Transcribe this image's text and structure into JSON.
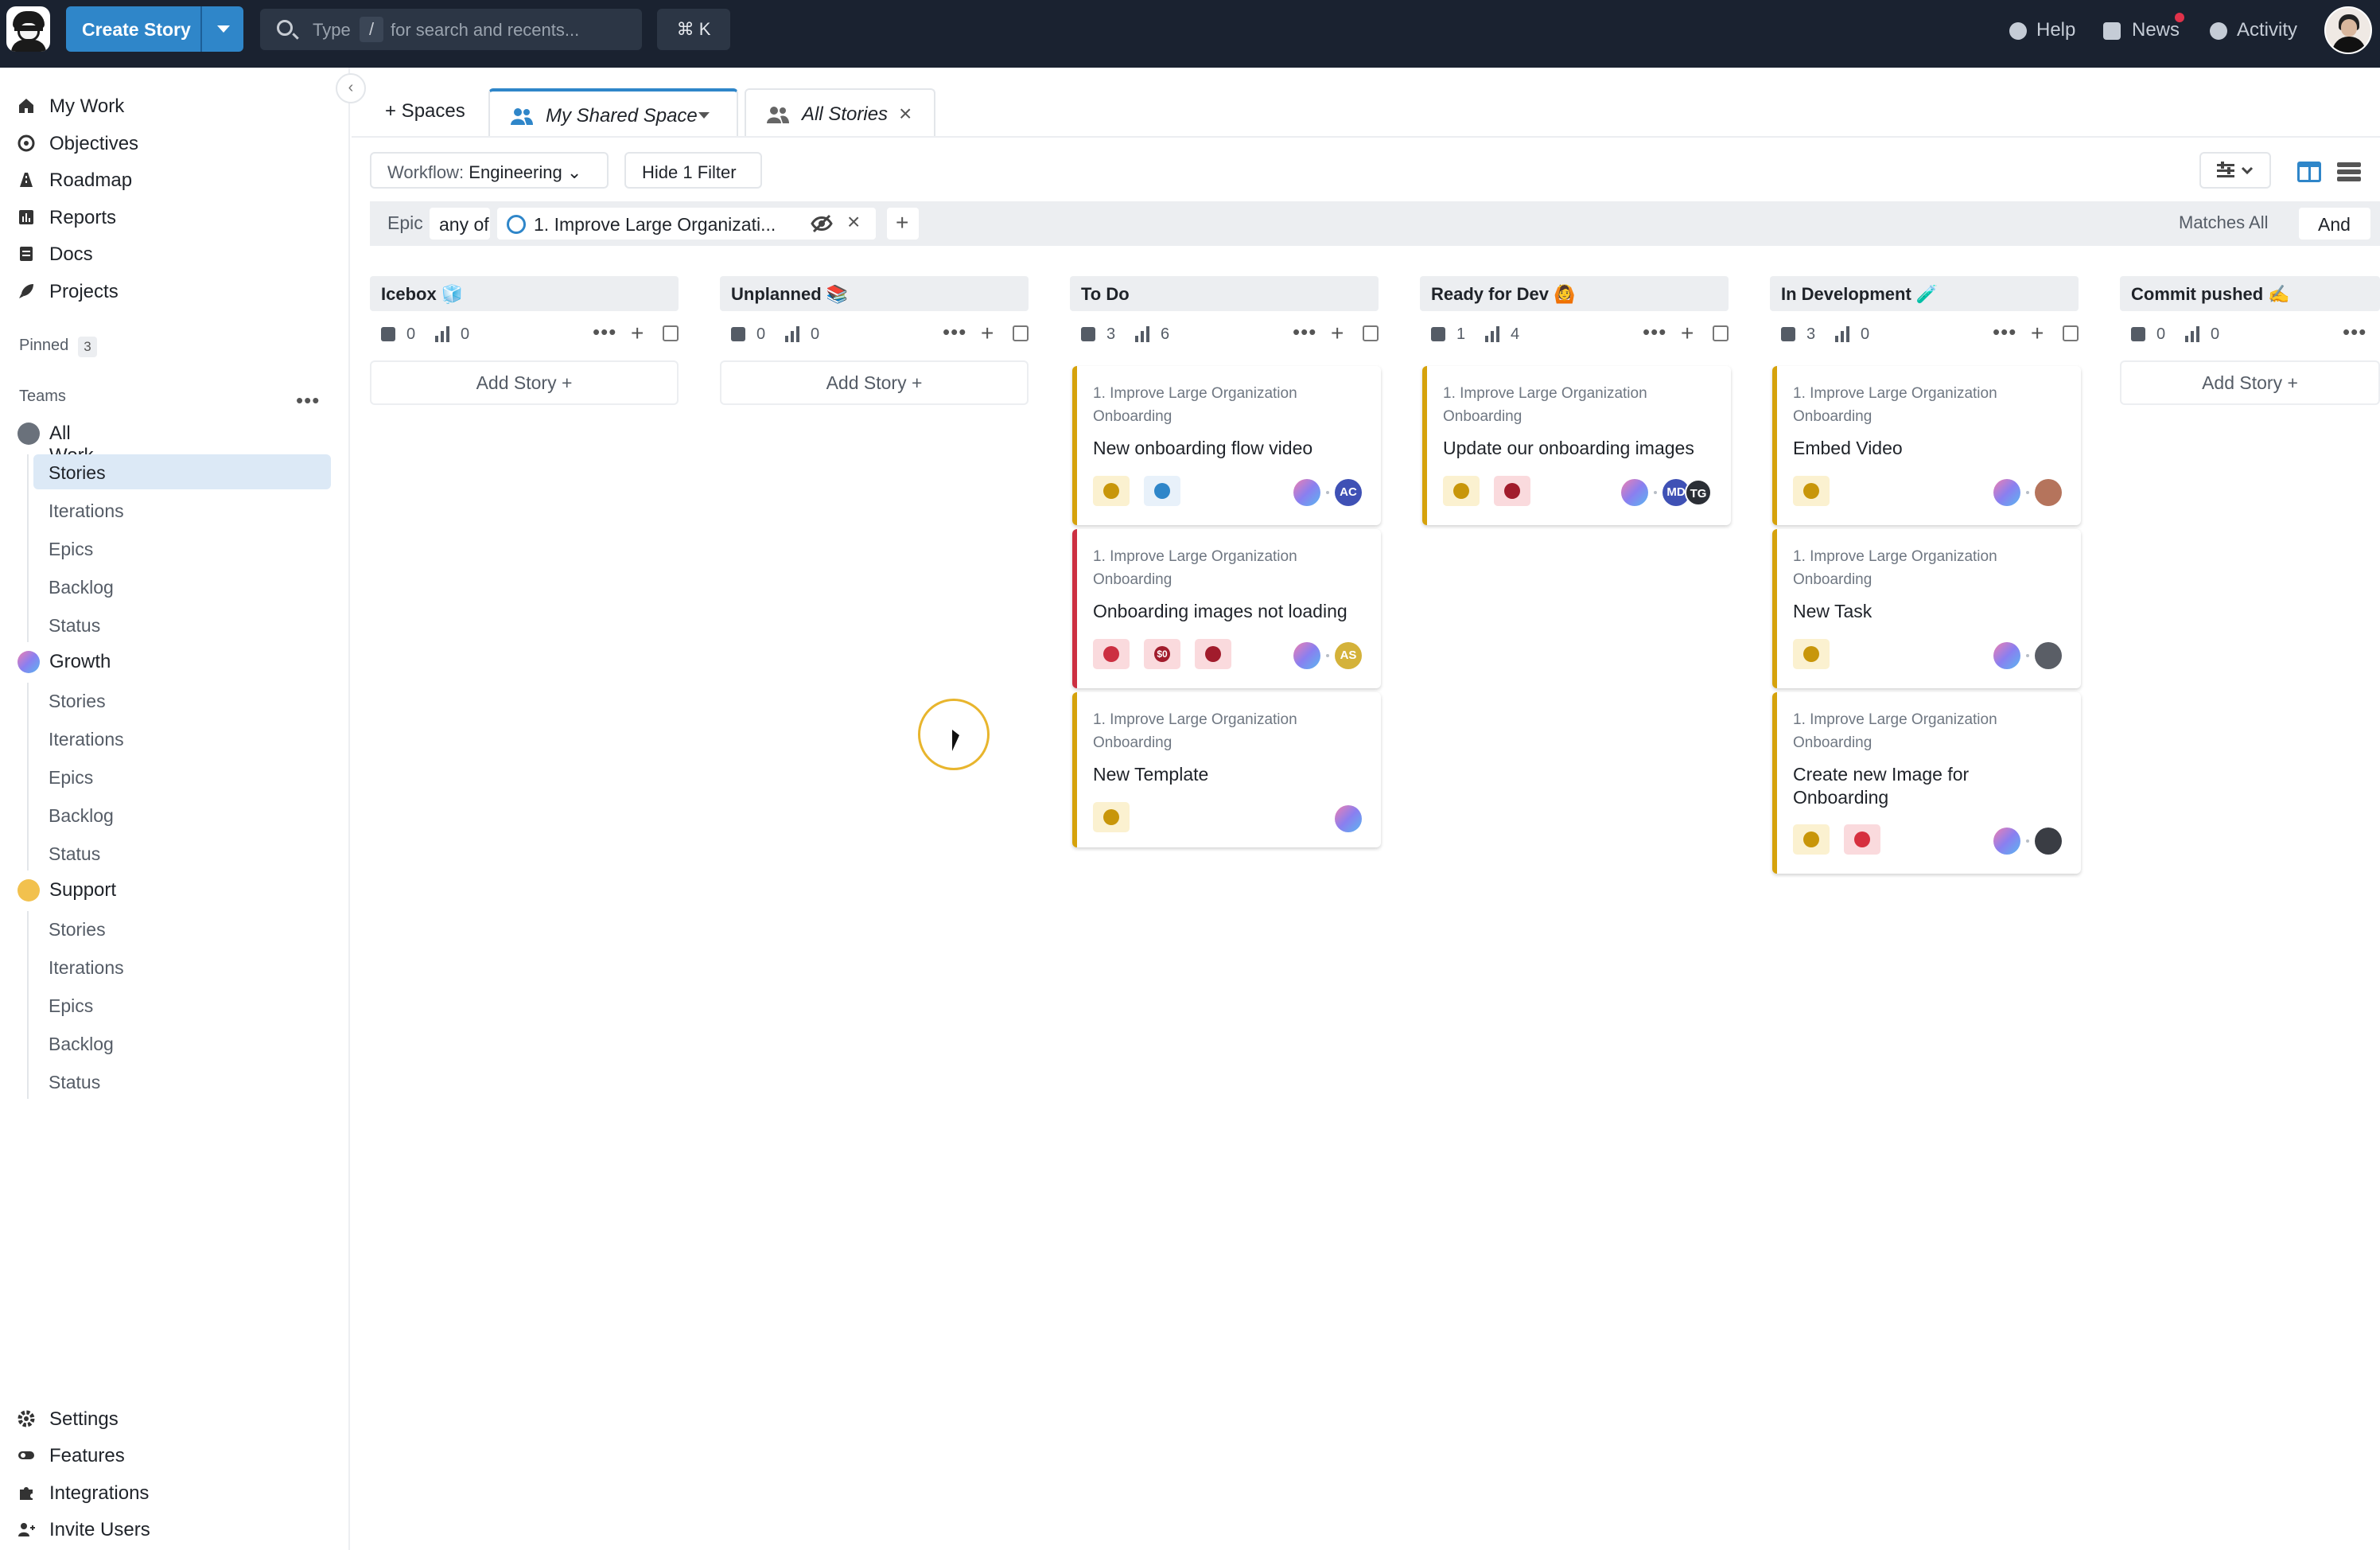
{
  "topbar": {
    "create_story": "Create Story",
    "search_prefix": "Type",
    "search_key": "/",
    "search_suffix": "for search and recents...",
    "cmd_k": "⌘ K",
    "help": "Help",
    "news": "News",
    "activity": "Activity"
  },
  "sidebar": {
    "main": [
      "My Work",
      "Objectives",
      "Roadmap",
      "Reports",
      "Docs",
      "Projects"
    ],
    "pinned_label": "Pinned",
    "pinned_count": "3",
    "teams_label": "Teams",
    "all_work": "All Work",
    "all_work_items": [
      "Stories",
      "Iterations",
      "Epics",
      "Backlog",
      "Status"
    ],
    "growth": "Growth",
    "growth_items": [
      "Stories",
      "Iterations",
      "Epics",
      "Backlog",
      "Status"
    ],
    "support": "Support",
    "support_items": [
      "Stories",
      "Iterations",
      "Epics",
      "Backlog",
      "Status"
    ],
    "bottom": [
      "Settings",
      "Features",
      "Integrations",
      "Invite Users"
    ]
  },
  "tabs": {
    "spaces": "+ Spaces",
    "my_shared_space": "My Shared Space",
    "all_stories": "All Stories"
  },
  "toolbar": {
    "workflow_prefix": "Workflow:",
    "workflow_value": "Engineering",
    "hide_filter": "Hide 1 Filter",
    "filter_field": "Epic",
    "filter_op": "any of",
    "filter_value": "1. Improve Large Organizati...",
    "matches": "Matches All",
    "and": "And"
  },
  "columns": [
    {
      "name": "Icebox 🧊",
      "stories": "0",
      "points": "0",
      "add": "Add Story +"
    },
    {
      "name": "Unplanned 📚",
      "stories": "0",
      "points": "0",
      "add": "Add Story +"
    },
    {
      "name": "To Do",
      "stories": "3",
      "points": "6"
    },
    {
      "name": "Ready for Dev 🙆",
      "stories": "1",
      "points": "4"
    },
    {
      "name": "In Development 🧪",
      "stories": "3",
      "points": "0"
    },
    {
      "name": "Commit pushed ✍️",
      "stories": "0",
      "points": "0",
      "add": "Add Story +"
    }
  ],
  "cards": {
    "epic_line1": "1. Improve Large Organization",
    "epic_line2": "Onboarding",
    "todo": [
      {
        "title": "New onboarding flow video",
        "avatar": "AC"
      },
      {
        "title": "Onboarding images not loading",
        "estimate": "$0",
        "avatar": "AS"
      },
      {
        "title": "New Template"
      }
    ],
    "ready": [
      {
        "title": "Update our onboarding images",
        "avatars": [
          "MD",
          "TG"
        ]
      }
    ],
    "dev": [
      {
        "title": "Embed Video"
      },
      {
        "title": "New Task"
      },
      {
        "title_line1": "Create new Image for",
        "title_line2": "Onboarding"
      }
    ]
  },
  "colors": {
    "topbar": "#1a2230",
    "accent": "#2f86c9",
    "feature": "#d6a20b",
    "bug": "#cc2f41"
  }
}
